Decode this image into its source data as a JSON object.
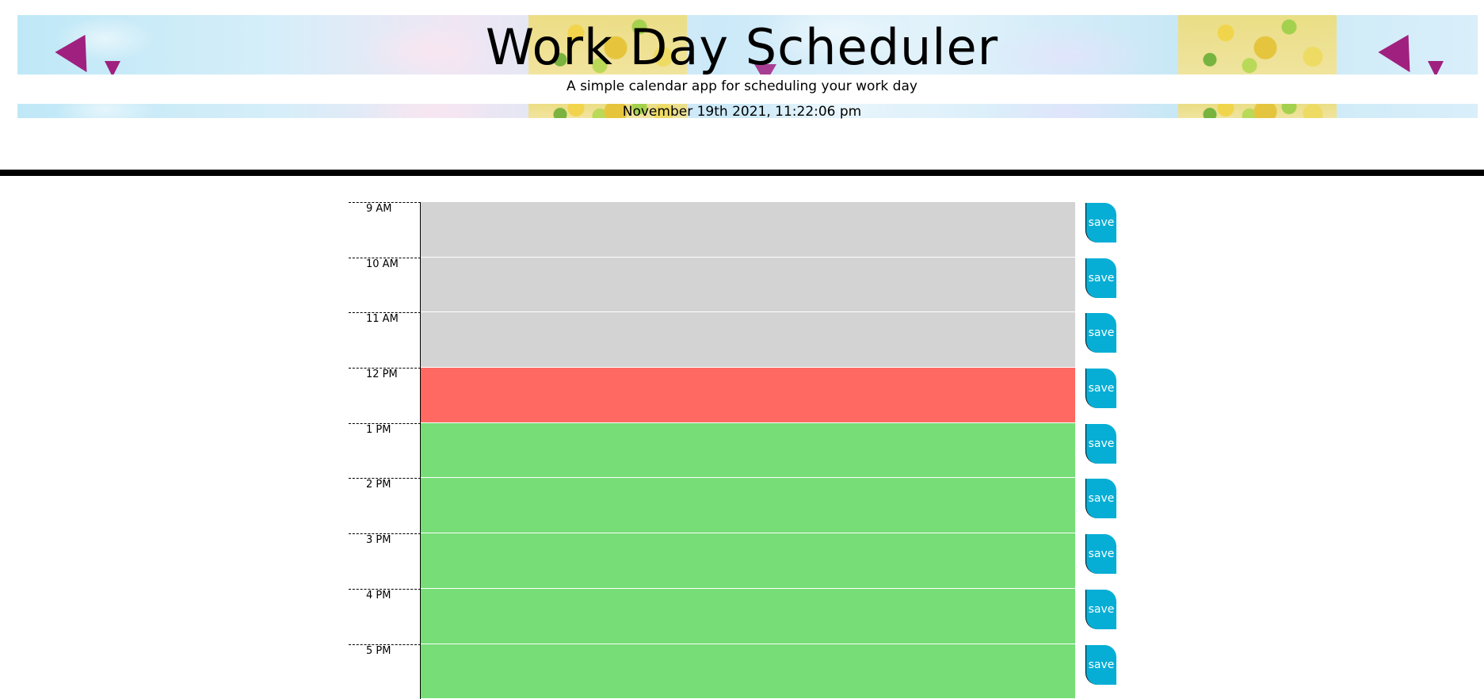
{
  "header": {
    "title": "Work Day Scheduler",
    "subtitle": "A simple calendar app for scheduling your work day",
    "current_day": "November 19th 2021, 11:22:06 pm"
  },
  "colors": {
    "past": "#d3d3d3",
    "present": "#ff6961",
    "future": "#77dd77",
    "save_button": "#06aed5"
  },
  "time_blocks": [
    {
      "hour": "9 AM",
      "state": "past",
      "text": "",
      "save_label": "save"
    },
    {
      "hour": "10 AM",
      "state": "past",
      "text": "",
      "save_label": "save"
    },
    {
      "hour": "11 AM",
      "state": "past",
      "text": "",
      "save_label": "save"
    },
    {
      "hour": "12 PM",
      "state": "present",
      "text": "",
      "save_label": "save"
    },
    {
      "hour": "1 PM",
      "state": "future",
      "text": "",
      "save_label": "save"
    },
    {
      "hour": "2 PM",
      "state": "future",
      "text": "",
      "save_label": "save"
    },
    {
      "hour": "3 PM",
      "state": "future",
      "text": "",
      "save_label": "save"
    },
    {
      "hour": "4 PM",
      "state": "future",
      "text": "",
      "save_label": "save"
    },
    {
      "hour": "5 PM",
      "state": "future",
      "text": "",
      "save_label": "save"
    }
  ]
}
